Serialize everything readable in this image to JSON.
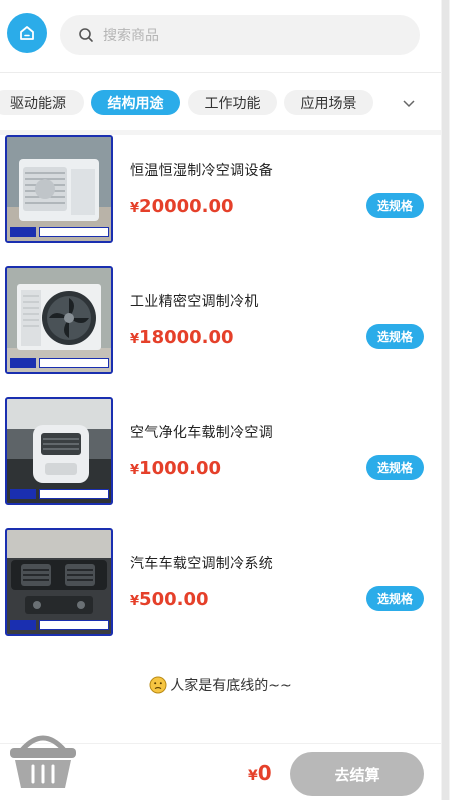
{
  "search": {
    "placeholder": "搜索商品",
    "icon": "search-icon"
  },
  "home": {
    "icon": "home-icon"
  },
  "tabs": [
    {
      "label": "驱动能源",
      "active": false
    },
    {
      "label": "结构用途",
      "active": true
    },
    {
      "label": "工作功能",
      "active": false
    },
    {
      "label": "应用场景",
      "active": false
    }
  ],
  "products": [
    {
      "name": "恒温恒湿制冷空调设备",
      "currency": "¥",
      "price": "20000.00",
      "button": "选规格",
      "image": "outdoor-ac-unit"
    },
    {
      "name": "工业精密空调制冷机",
      "currency": "¥",
      "price": "18000.00",
      "button": "选规格",
      "image": "industrial-ac-unit"
    },
    {
      "name": "空气净化车载制冷空调",
      "currency": "¥",
      "price": "1000.00",
      "button": "选规格",
      "image": "car-air-purifier"
    },
    {
      "name": "汽车车载空调制冷系统",
      "currency": "¥",
      "price": "500.00",
      "button": "选规格",
      "image": "car-dashboard-vents"
    }
  ],
  "end_note": "人家是有底线的~~",
  "cart": {
    "currency": "¥",
    "total": "0",
    "checkout_label": "去结算",
    "icon": "basket-icon"
  },
  "colors": {
    "accent": "#2bace9",
    "price": "#e5402a",
    "checkout_disabled": "#b8b8b8",
    "thumb_border": "#1a2fb0"
  }
}
